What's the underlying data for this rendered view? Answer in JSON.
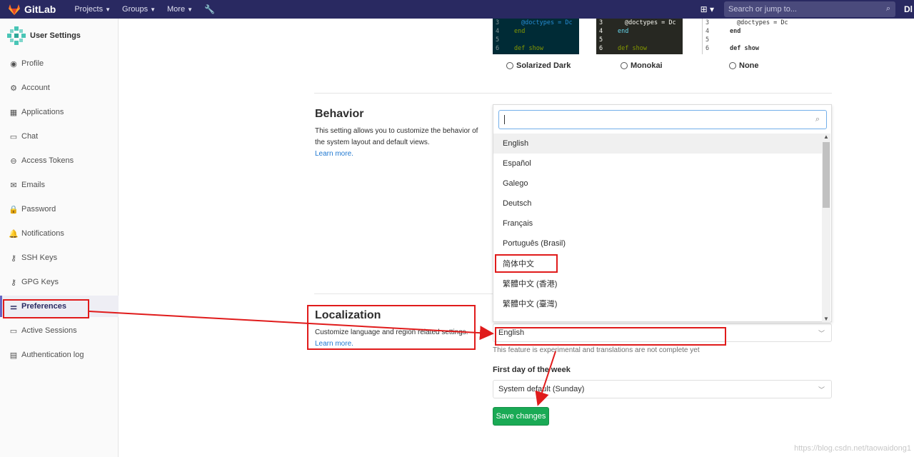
{
  "topnav": {
    "brand": "GitLab",
    "menu": [
      {
        "label": "Projects"
      },
      {
        "label": "Groups"
      },
      {
        "label": "More"
      }
    ],
    "search_placeholder": "Search or jump to...",
    "avatar_text": "Dl",
    "brand_color": "#292961"
  },
  "sidebar": {
    "title": "User Settings",
    "items": [
      {
        "label": "Profile",
        "icon": "profile-icon"
      },
      {
        "label": "Account",
        "icon": "account-icon"
      },
      {
        "label": "Applications",
        "icon": "applications-icon"
      },
      {
        "label": "Chat",
        "icon": "chat-icon"
      },
      {
        "label": "Access Tokens",
        "icon": "token-icon"
      },
      {
        "label": "Emails",
        "icon": "email-icon"
      },
      {
        "label": "Password",
        "icon": "lock-icon"
      },
      {
        "label": "Notifications",
        "icon": "bell-icon"
      },
      {
        "label": "SSH Keys",
        "icon": "key-icon"
      },
      {
        "label": "GPG Keys",
        "icon": "key-icon"
      },
      {
        "label": "Preferences",
        "icon": "sliders-icon",
        "active": true
      },
      {
        "label": "Active Sessions",
        "icon": "monitor-icon"
      },
      {
        "label": "Authentication log",
        "icon": "log-icon"
      }
    ]
  },
  "syntax_themes": {
    "code_lines": [
      {
        "num": "3",
        "text": "@doctypes = Dc"
      },
      {
        "num": "4",
        "text": "end"
      },
      {
        "num": "5",
        "text": ""
      },
      {
        "num": "6",
        "text": "def show"
      }
    ],
    "options": [
      {
        "label": "Solarized Dark"
      },
      {
        "label": "Monokai"
      },
      {
        "label": "None"
      }
    ]
  },
  "behavior": {
    "title": "Behavior",
    "description": "This setting allows you to customize the behavior of the system layout and default views.",
    "learn_more": "Learn more."
  },
  "language_dropdown": {
    "search_value": "",
    "options": [
      {
        "label": "English",
        "highlighted": true
      },
      {
        "label": "Español"
      },
      {
        "label": "Galego"
      },
      {
        "label": "Deutsch"
      },
      {
        "label": "Français"
      },
      {
        "label": "Português (Brasil)"
      },
      {
        "label": "简体中文"
      },
      {
        "label": "繁體中文 (香港)"
      },
      {
        "label": "繁體中文 (臺灣)"
      }
    ]
  },
  "localization": {
    "title": "Localization",
    "description": "Customize language and region related settings.",
    "learn_more": "Learn more.",
    "language_value": "English",
    "help_text": "This feature is experimental and translations are not complete yet",
    "first_day_label": "First day of the week",
    "first_day_value": "System default (Sunday)",
    "save_label": "Save changes"
  },
  "watermark": "https://blog.csdn.net/taowaidong1",
  "colors": {
    "annotation_red": "#e01b1b",
    "save_green": "#1aaa55",
    "link_blue": "#1f78d1"
  }
}
